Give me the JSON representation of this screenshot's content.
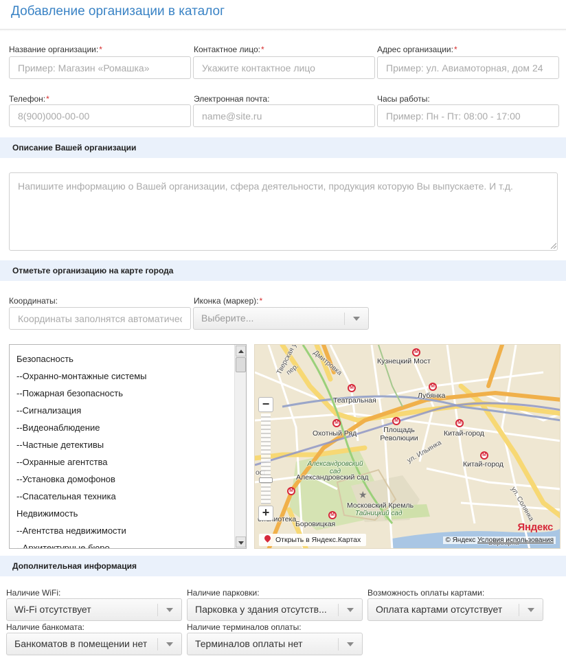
{
  "page": {
    "title": "Добавление организации в каталог"
  },
  "fields": {
    "org_name": {
      "label": "Название организации:",
      "required": "*",
      "placeholder": "Пример: Магазин «Ромашка»"
    },
    "contact": {
      "label": "Контактное лицо:",
      "required": "*",
      "placeholder": "Укажите контактное лицо"
    },
    "address": {
      "label": "Адрес организации:",
      "required": "*",
      "placeholder": "Пример: ул. Авиамоторная, дом 24"
    },
    "phone": {
      "label": "Телефон:",
      "required": "*",
      "placeholder": "8(900)000-00-00"
    },
    "email": {
      "label": "Электронная почта:",
      "placeholder": "name@site.ru"
    },
    "hours": {
      "label": "Часы работы:",
      "placeholder": "Пример: Пн - Пт: 08:00 - 17:00"
    }
  },
  "description": {
    "heading": "Описание Вашей организации",
    "placeholder": "Напишите информацию о Вашей организации, сфера деятельности, продукция которую Вы выпускаете. И т.д."
  },
  "map_section": {
    "heading": "Отметьте организацию на карте города",
    "coords_label": "Координаты:",
    "coords_placeholder": "Координаты заполнятся автоматически",
    "icon_label": "Иконка (маркер):",
    "icon_required": "*",
    "icon_select": "Выберите..."
  },
  "categories": [
    "Безопасность",
    "--Охранно-монтажные системы",
    "--Пожарная безопасность",
    "--Сигнализация",
    "--Видеонаблюдение",
    "--Частные детективы",
    "--Охранные агентства",
    "--Установка домофонов",
    "--Спасательная техника",
    "Недвижимость",
    "--Агентства недвижимости",
    "--Архитектурные бюро"
  ],
  "map": {
    "labels": {
      "kuznetsky": "Кузнецкий Мост",
      "teatralnaya": "Театральная",
      "lubyanka": "Лубянка",
      "okhotny": "Охотный Ряд",
      "revolution": "Площадь Революции",
      "kitay1": "Китай-город",
      "kitay2": "Китай-город",
      "alex_garden_green": "Александровский сад",
      "alex_garden": "Александровский сад",
      "kremlin": "Московский Кремль",
      "tainitsky": "Тайницкий сад",
      "borovitskaya": "Боровицкая",
      "biblioteka": "библиотека",
      "street_tverskaya": "Тверская ул.",
      "street_solyanka": "ул. Солянка",
      "street_ilyinka": "ул. Ильинка",
      "street_varvarka": "Варварка",
      "street_pereulok": "пер.",
      "street_dmitrovka": "Дмитровка",
      "street_nost": "ост"
    },
    "open_link": "Открыть в Яндекс.Картах",
    "logo": "Яндекс",
    "copyright": "© Яндекс",
    "terms": "Условия использования",
    "zoom_in": "+",
    "zoom_out": "−"
  },
  "extra": {
    "heading": "Дополнительная информация",
    "wifi": {
      "label": "Наличие WiFi:",
      "value": "Wi-Fi отсутствует"
    },
    "parking": {
      "label": "Наличие парковки:",
      "value": "Парковка у здания отсутств..."
    },
    "cards": {
      "label": "Возможность оплаты картами:",
      "value": "Оплата картами отсутствует"
    },
    "atm": {
      "label": "Наличие банкомата:",
      "value": "Банкоматов в помещении нет"
    },
    "terminals": {
      "label": "Наличие терминалов оплаты:",
      "value": "Терминалов оплаты нет"
    }
  }
}
